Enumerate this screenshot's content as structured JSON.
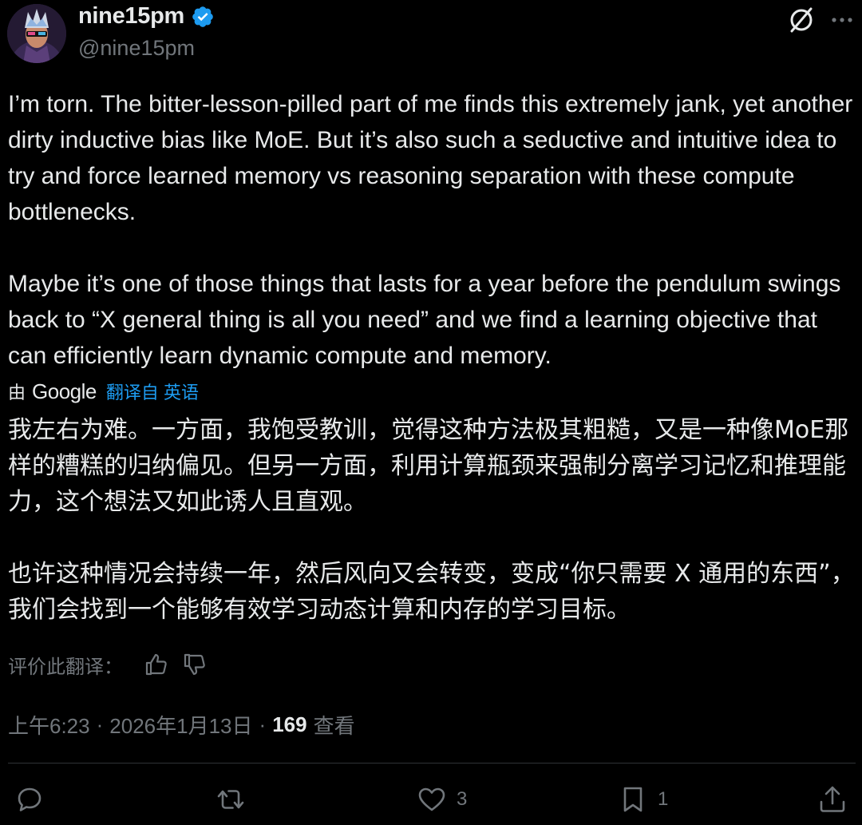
{
  "author": {
    "display_name": "nine15pm",
    "handle": "@nine15pm",
    "verified": true
  },
  "icons": {
    "verified": "verified-badge-icon",
    "grok": "grok-icon",
    "more": "more-icon",
    "thumbs_up": "thumbs-up-icon",
    "thumbs_down": "thumbs-down-icon",
    "reply": "reply-icon",
    "repost": "repost-icon",
    "like": "like-icon",
    "bookmark": "bookmark-icon",
    "share": "share-icon"
  },
  "tweet": {
    "text": "I’m torn. The bitter-lesson-pilled part of me finds this extremely jank, yet another dirty inductive bias like MoE. But it’s also such a seductive and intuitive idea to try and force learned memory vs reasoning separation with these compute bottlenecks.\n\nMaybe it’s one of those things that lasts for a year before the pendulum swings back to “X general thing is all you need” and we find a learning objective that can efficiently learn dynamic compute and memory."
  },
  "translation": {
    "by_label": "由",
    "provider": "Google",
    "link_label": "翻译自 英语",
    "text": "我左右为难。一方面，我饱受教训，觉得这种方法极其粗糙，又是一种像MoE那样的糟糕的归纳偏见。但另一方面，利用计算瓶颈来强制分离学习记忆和推理能力，这个想法又如此诱人且直观。\n\n也许这种情况会持续一年，然后风向又会转变，变成“你只需要 X 通用的东西”，我们会找到一个能够有效学习动态计算和内存的学习目标。",
    "rate_label": "评价此翻译："
  },
  "meta": {
    "time": "上午6:23",
    "separator": "·",
    "date": "2026年1月13日",
    "views_count": "169",
    "views_label": "查看"
  },
  "actions": {
    "replies": "",
    "reposts": "",
    "likes": "3",
    "bookmarks": "1"
  },
  "colors": {
    "background": "#000000",
    "text_primary": "#e7e9ea",
    "text_secondary": "#71767b",
    "accent": "#1d9bf0",
    "divider": "#2f3336"
  }
}
